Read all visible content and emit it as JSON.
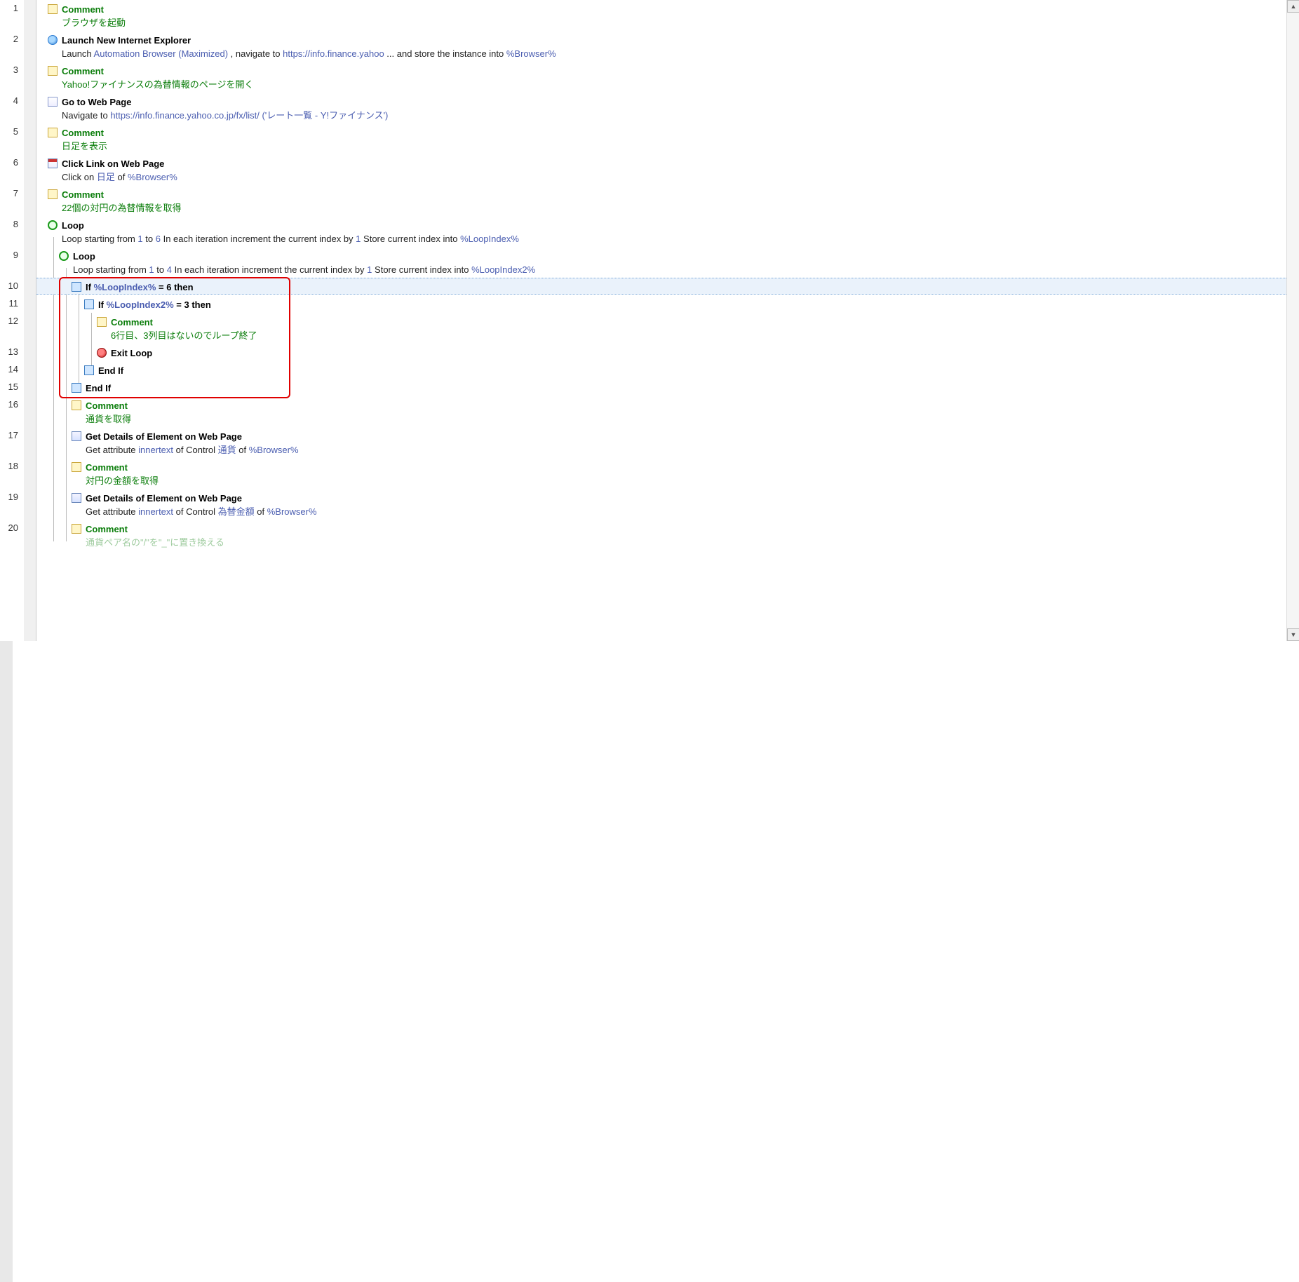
{
  "lineNumbers": [
    "1",
    "2",
    "3",
    "4",
    "5",
    "6",
    "7",
    "8",
    "9",
    "10",
    "11",
    "12",
    "13",
    "14",
    "15",
    "16",
    "17",
    "18",
    "19",
    "20"
  ],
  "lineTops": [
    4,
    48,
    92,
    136,
    180,
    224,
    268,
    312,
    356,
    400,
    425,
    450,
    494,
    519,
    544,
    569,
    613,
    657,
    701,
    745
  ],
  "rows": {
    "r1": {
      "title": "Comment",
      "desc": "ブラウザを起動"
    },
    "r2": {
      "title": "Launch New Internet Explorer",
      "pre": "Launch ",
      "link1": "Automation",
      "link2": "Browser",
      "link3": "(Maximized)",
      "mid": " , navigate  to ",
      "url": "https://info.finance.yahoo",
      "ell": "  ... ",
      "tail": "and store the instance  into  ",
      "var": "%Browser%"
    },
    "r3": {
      "title": "Comment",
      "desc": "Yahoo!ファイナンスの為替情報のページを開く"
    },
    "r4": {
      "title": "Go to Web Page",
      "pre": "Navigate to ",
      "url": "https://info.finance.yahoo.co.jp/fx/list/",
      "space": "    ",
      "paren": "('レート一覧 - Y!ファイナンス')"
    },
    "r5": {
      "title": "Comment",
      "desc": "日足を表示"
    },
    "r6": {
      "title": "Click Link on Web Page",
      "pre": "Click  on ",
      "link": "日足",
      "of": "  of  ",
      "var": "%Browser%"
    },
    "r7": {
      "title": "Comment",
      "desc": "22個の対円の為替情報を取得"
    },
    "r8": {
      "title": "Loop",
      "a": "Loop starting  from ",
      "n1": "1",
      "b": " to ",
      "n2": "6",
      "c": " In each iteration  increment  the current index by ",
      "n3": "1",
      "d": " Store current index into  ",
      "var": "%LoopIndex%"
    },
    "r9": {
      "title": "Loop",
      "a": "Loop starting  from ",
      "n1": "1",
      "b": " to ",
      "n2": "4",
      "c": " In each iteration  increment  the current index by ",
      "n3": "1",
      "d": " Store current index into  ",
      "var": "%LoopIndex2%"
    },
    "r10": {
      "ifw": "If ",
      "var": "%LoopIndex%",
      "eq": "  = 6 ",
      "then": "then"
    },
    "r11": {
      "ifw": "If ",
      "var": "%LoopIndex2%",
      "eq": "  = 3 ",
      "then": "then"
    },
    "r12": {
      "title": "Comment",
      "desc": "6行目、3列目はないのでループ終了"
    },
    "r13": {
      "title": "Exit Loop"
    },
    "r14": {
      "title": "End If"
    },
    "r15": {
      "title": "End If"
    },
    "r16": {
      "title": "Comment",
      "desc": "通貨を取得"
    },
    "r17": {
      "title": "Get Details of Element on Web Page",
      "a": "Get attribute  ",
      "attr": "innertext",
      "b": "  of Control ",
      "ctrl": "通貨",
      "c": " of  ",
      "var": "%Browser%"
    },
    "r18": {
      "title": "Comment",
      "desc": "対円の金額を取得"
    },
    "r19": {
      "title": "Get Details of Element on Web Page",
      "a": "Get attribute  ",
      "attr": "innertext",
      "b": "  of Control ",
      "ctrl": "為替金額",
      "c": " of  ",
      "var": "%Browser%"
    },
    "r20": {
      "title": "Comment",
      "desc": "通貨ペア名の\"/\"を\"_\"に置き換える"
    }
  }
}
